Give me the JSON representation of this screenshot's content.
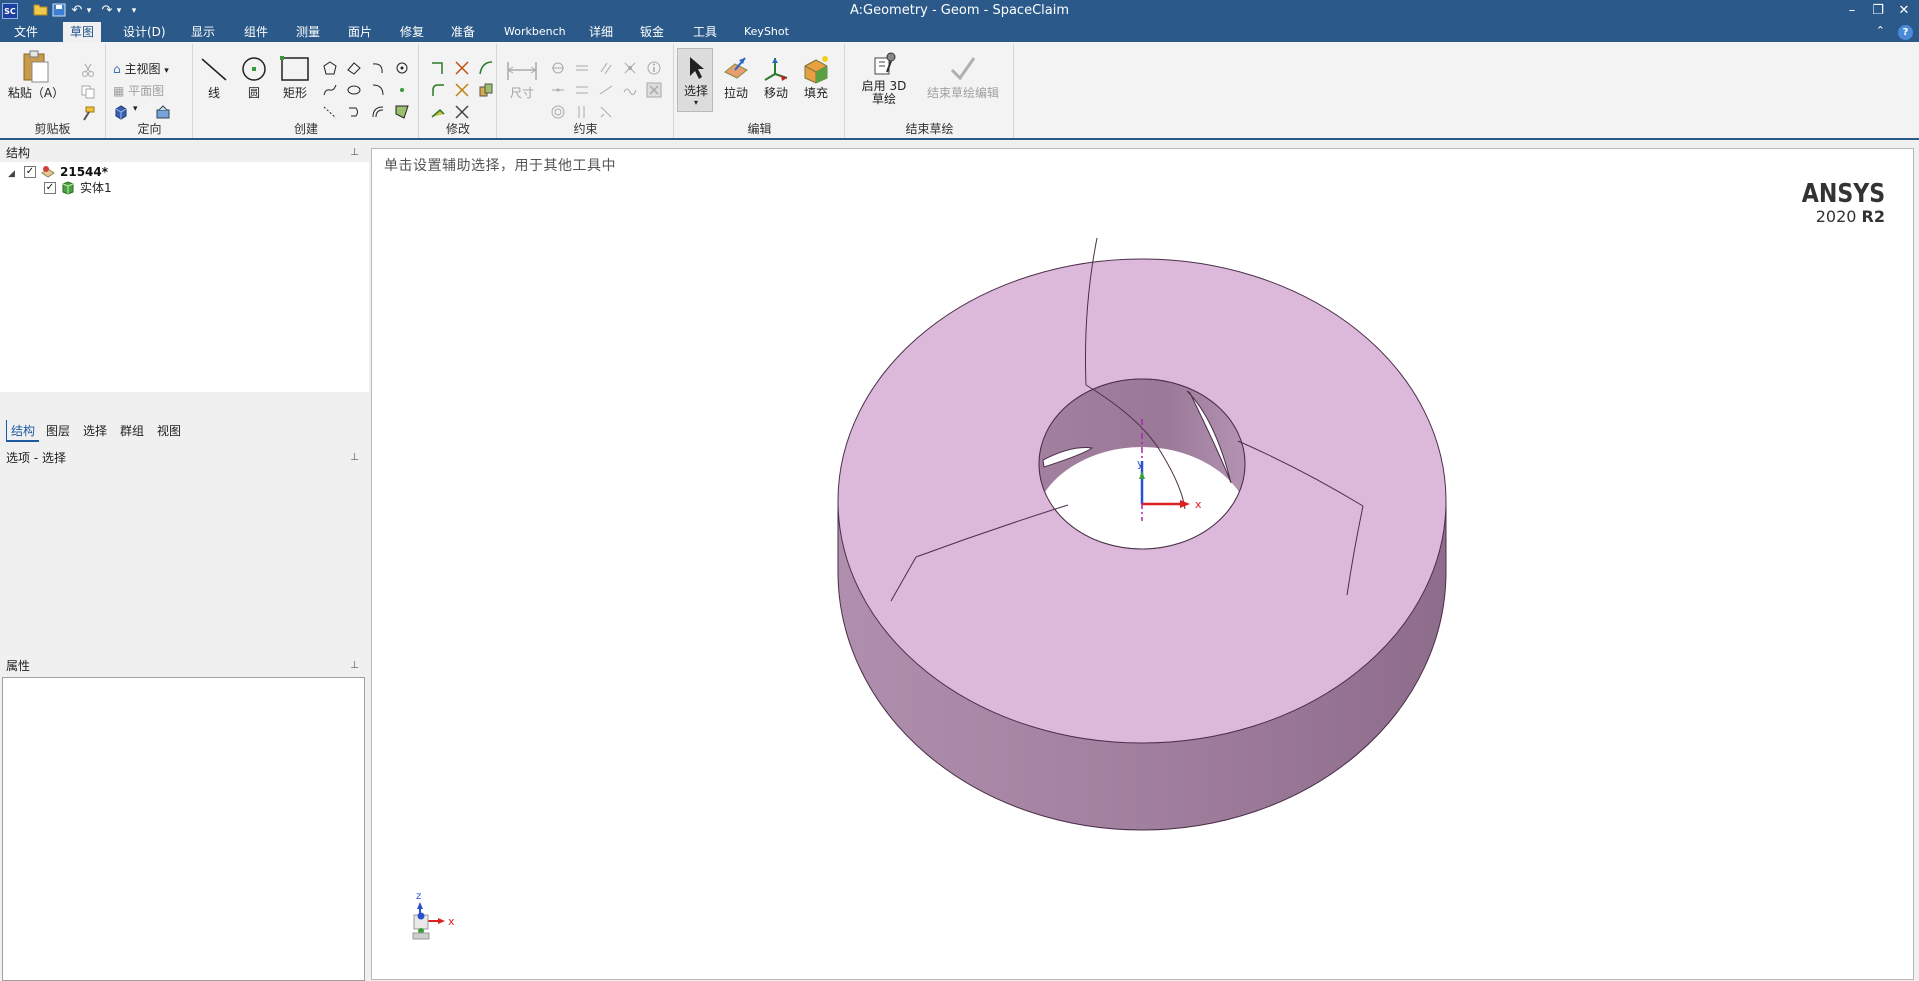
{
  "window": {
    "app_icon_text": "SC",
    "title": "A:Geometry - Geom - SpaceClaim",
    "buttons": {
      "minimize": "–",
      "restore": "❐",
      "close": "✕"
    }
  },
  "quick_access": {
    "open": "📂",
    "save": "💾",
    "undo": "↶",
    "redo": "↷",
    "dropdown": "▾"
  },
  "menu": {
    "items": [
      "文件",
      "草图",
      "设计(D)",
      "显示",
      "组件",
      "测量",
      "面片",
      "修复",
      "准备",
      "Workbench",
      "详细",
      "钣金",
      "工具",
      "KeyShot"
    ],
    "active_index": 1,
    "help": "?"
  },
  "ribbon": {
    "clipboard": {
      "label": "剪贴板",
      "paste": "粘贴（A）"
    },
    "orient": {
      "label": "定向",
      "home": "主视图",
      "plan": "平面图"
    },
    "create": {
      "label": "创建",
      "line": "线",
      "circle": "圆",
      "rect": "矩形"
    },
    "modify": {
      "label": "修改"
    },
    "constraint": {
      "label": "约束",
      "dimension": "尺寸"
    },
    "edit": {
      "label": "编辑",
      "select": "选择",
      "pull": "拉动",
      "move": "移动",
      "fill": "填充"
    },
    "end_sketch": {
      "label": "结束草绘",
      "enable3d": "启用 3D 草绘",
      "end_edit": "结束草绘编辑"
    }
  },
  "structure_panel": {
    "title": "结构",
    "root": "21544*",
    "child": "实体1"
  },
  "left_tabs": {
    "items": [
      "结构",
      "图层",
      "选择",
      "群组",
      "视图"
    ],
    "active_index": 0
  },
  "options_panel": {
    "title": "选项 - 选择"
  },
  "properties_panel": {
    "title": "属性"
  },
  "viewport": {
    "hint": "单击设置辅助选择，用于其他工具中",
    "brand_name": "ANSYS",
    "brand_year": "2020",
    "brand_release": "R2",
    "axis_x": "x",
    "axis_y": "y",
    "axis_z": "z",
    "colors": {
      "top_face": "#dcb8db",
      "side_face": "#a883a4",
      "edge": "#4a2f48",
      "bore": "#8e6a8b"
    }
  }
}
